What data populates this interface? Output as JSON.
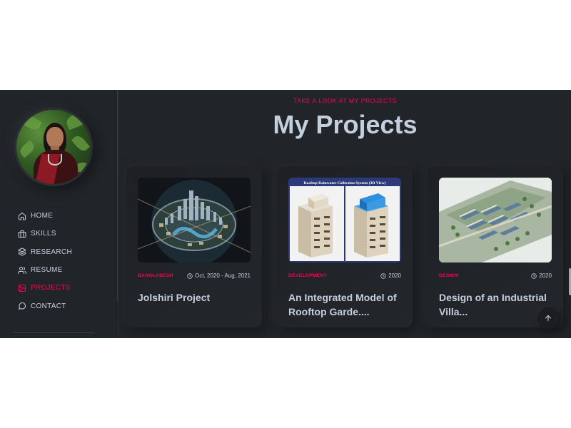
{
  "sidebar": {
    "items": [
      {
        "label": "HOME",
        "icon": "home-icon"
      },
      {
        "label": "SKILLS",
        "icon": "briefcase-icon"
      },
      {
        "label": "RESEARCH",
        "icon": "layers-icon"
      },
      {
        "label": "RESUME",
        "icon": "users-icon"
      },
      {
        "label": "PROJECTS",
        "icon": "image-icon",
        "active": true
      },
      {
        "label": "CONTACT",
        "icon": "message-circle-icon"
      }
    ]
  },
  "main": {
    "eyebrow": "TAKE A LOOK AT MY PROJECTS",
    "title": "My Projects",
    "projects": [
      {
        "category": "BANGLADESH",
        "date": "Oct, 2020 - Aug, 2021",
        "title": "Jolshiri Project"
      },
      {
        "category": "DEVELOPMENT",
        "date": "2020",
        "title": "An Integrated Model of Rooftop Garde....",
        "image_caption": "Rooftop Rainwater Collection System (3D View)"
      },
      {
        "category": "DESIGN",
        "date": "2020",
        "title": "Design of an Industrial Villa..."
      }
    ]
  },
  "colors": {
    "background": "#212428",
    "accent": "#ff014f",
    "text": "#c4cfde"
  }
}
